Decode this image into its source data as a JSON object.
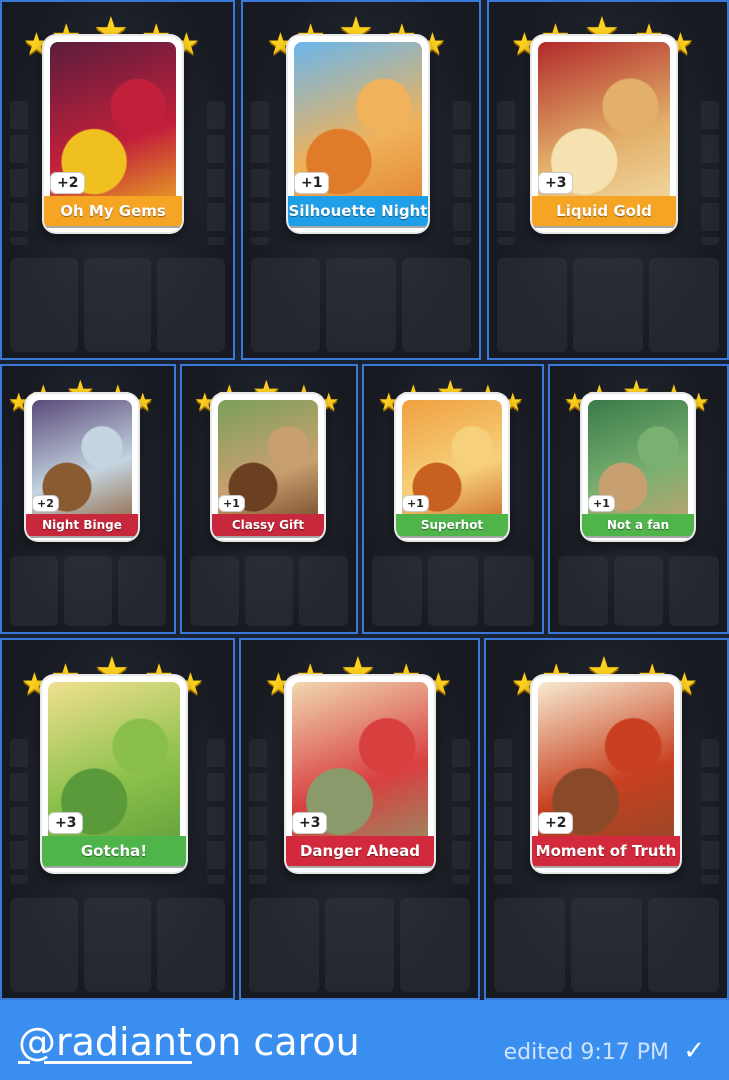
{
  "cards": [
    {
      "title": "Oh My Gems",
      "plus": "+2",
      "ribbon": "#f5a424",
      "art": [
        "#5a1d3d",
        "#c2203a",
        "#f0c020"
      ]
    },
    {
      "title": "Silhouette Night",
      "plus": "+1",
      "ribbon": "#1e9fe8",
      "art": [
        "#6ab6ec",
        "#f0b25a",
        "#e07b2a"
      ]
    },
    {
      "title": "Liquid Gold",
      "plus": "+3",
      "ribbon": "#f5a424",
      "art": [
        "#b12a2a",
        "#e2b06a",
        "#f6e2b0"
      ]
    },
    {
      "title": "Night Binge",
      "plus": "+2",
      "ribbon": "#c8283c",
      "art": [
        "#5a4a7a",
        "#c4d4e0",
        "#8a5a30"
      ]
    },
    {
      "title": "Classy Gift",
      "plus": "+1",
      "ribbon": "#c8283c",
      "art": [
        "#7aa05a",
        "#c8a070",
        "#6a4020"
      ]
    },
    {
      "title": "Superhot",
      "plus": "+1",
      "ribbon": "#4fb54a",
      "art": [
        "#f0a040",
        "#f6d07a",
        "#c86020"
      ]
    },
    {
      "title": "Not a fan",
      "plus": "+1",
      "ribbon": "#4fb54a",
      "art": [
        "#3a7a4a",
        "#7ab070",
        "#c8a070"
      ]
    },
    {
      "title": "Gotcha!",
      "plus": "+3",
      "ribbon": "#4fb54a",
      "art": [
        "#f0e090",
        "#8ac04a",
        "#5a9a3a"
      ]
    },
    {
      "title": "Danger Ahead",
      "plus": "+3",
      "ribbon": "#d22a3c",
      "art": [
        "#f0d8b0",
        "#d84040",
        "#8a9a6a"
      ]
    },
    {
      "title": "Moment of Truth",
      "plus": "+2",
      "ribbon": "#d22a3c",
      "art": [
        "#f6ead0",
        "#c84020",
        "#8a4a2a"
      ]
    }
  ],
  "footer": {
    "handle": "@radiant",
    "text": "on carou",
    "edited": "edited 9:17 PM",
    "check": "✓"
  }
}
